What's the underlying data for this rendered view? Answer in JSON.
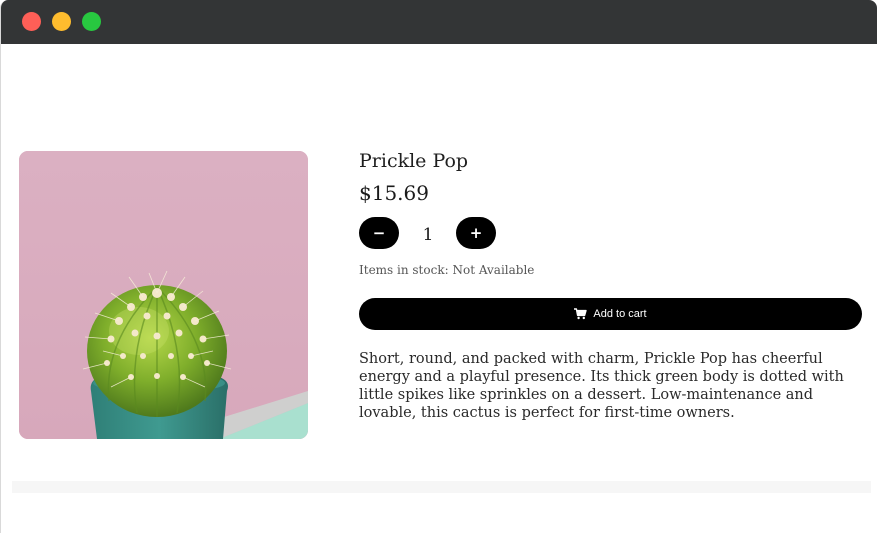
{
  "window": {
    "controls": [
      "close",
      "minimize",
      "maximize"
    ]
  },
  "product": {
    "image_icon": "cactus-photo",
    "name": "Prickle Pop",
    "price": "$15.69",
    "quantity": "1",
    "decrement_label": "−",
    "increment_label": "+",
    "stock_label": "Items in stock:",
    "stock_value": "Not Available",
    "cart_label": "Add to cart",
    "cart_icon": "cart-icon",
    "description": "Short, round, and packed with charm, Prickle Pop has cheerful energy and a playful presence. Its thick green body is dotted with little spikes like sprinkles on a dessert. Low-maintenance and lovable, this cactus is perfect for first-time owners."
  },
  "colors": {
    "titlebar": "#333536",
    "close": "#fe5f57",
    "minimize": "#febc2e",
    "maximize": "#28c840",
    "button": "#000000",
    "image_background": "#dbb0c2"
  }
}
